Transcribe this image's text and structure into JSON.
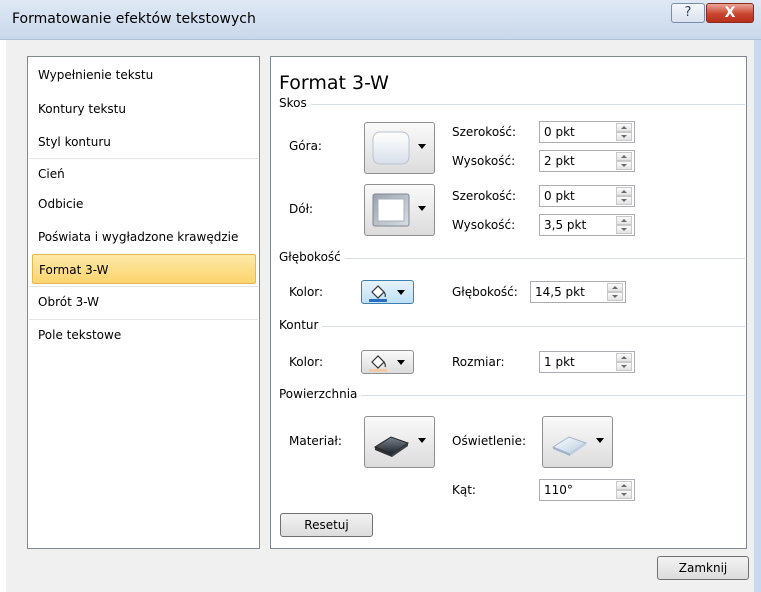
{
  "window": {
    "title": "Formatowanie efektów tekstowych",
    "help_label": "?",
    "close_label": "X"
  },
  "categories": [
    {
      "label": "Wypełnienie tekstu"
    },
    {
      "label": "Kontury tekstu"
    },
    {
      "label": "Styl konturu"
    },
    {
      "label": "Cień"
    },
    {
      "label": "Odbicie"
    },
    {
      "label": "Poświata i wygładzone krawędzie"
    },
    {
      "label": "Format 3-W"
    },
    {
      "label": "Obrót 3-W"
    },
    {
      "label": "Pole tekstowe"
    }
  ],
  "selected_category": "Format 3-W",
  "panel": {
    "title": "Format 3-W",
    "bevel": {
      "label": "Skos",
      "top_label": "Góra:",
      "bottom_label": "Dół:",
      "width_label": "Szerokość:",
      "height_label": "Wysokość:",
      "top_width": "0 pkt",
      "top_height": "2 pkt",
      "bottom_width": "0 pkt",
      "bottom_height": "3,5 pkt"
    },
    "depth": {
      "label": "Głębokość",
      "color_label": "Kolor:",
      "depth_label": "Głębokość:",
      "depth_value": "14,5 pkt"
    },
    "contour": {
      "label": "Kontur",
      "color_label": "Kolor:",
      "size_label": "Rozmiar:",
      "size_value": "1 pkt"
    },
    "surface": {
      "label": "Powierzchnia",
      "material_label": "Materiał:",
      "lighting_label": "Oświetlenie:",
      "angle_label": "Kąt:",
      "angle_value": "110°"
    },
    "reset_label": "Resetuj"
  },
  "footer": {
    "close_label": "Zamknij"
  },
  "icons": {
    "bevel_top": "bevel-preview-icon",
    "bevel_bottom": "bevel-preview-icon",
    "color": "paint-bucket-icon",
    "material": "material-preview-icon",
    "lighting": "lighting-preview-icon"
  },
  "colors": {
    "selected_bg": "#fbd46e",
    "selected_border": "#e3b94f",
    "close_button": "#c9452f",
    "depth_color_focus": "#3c7fb1"
  }
}
